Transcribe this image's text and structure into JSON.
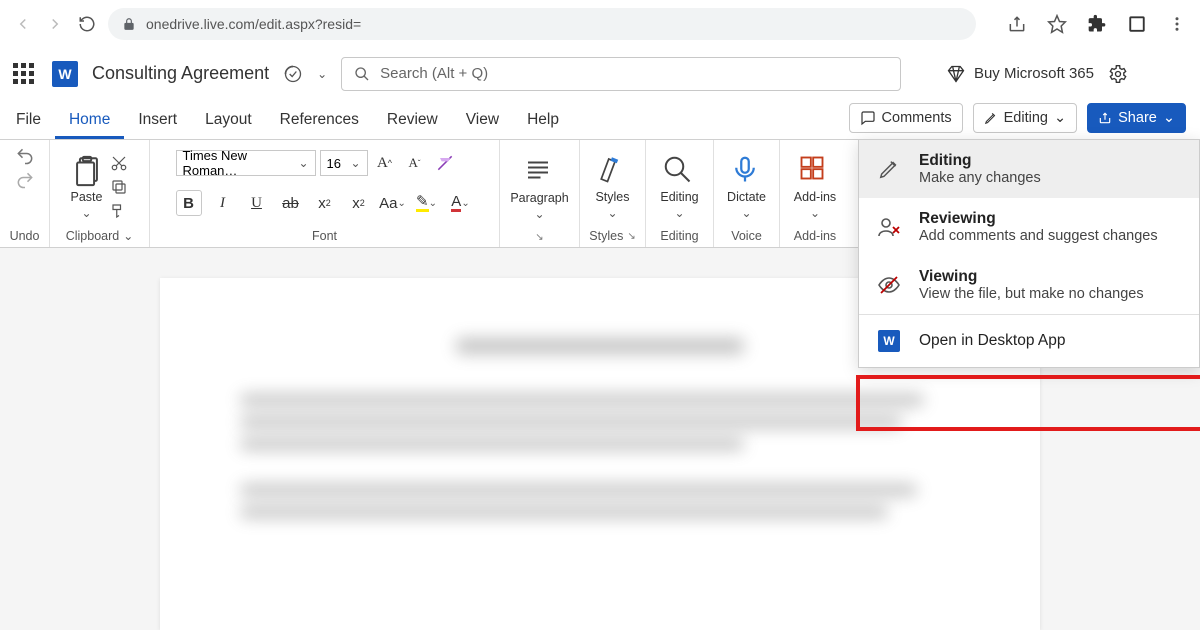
{
  "browser": {
    "url_display": "onedrive.live.com/edit.aspx?resid="
  },
  "header": {
    "doc_title": "Consulting Agreement",
    "search_placeholder": "Search (Alt + Q)",
    "buy_label": "Buy Microsoft 365"
  },
  "tabs": {
    "items": [
      "File",
      "Home",
      "Insert",
      "Layout",
      "References",
      "Review",
      "View",
      "Help"
    ],
    "active_index": 1,
    "comments_label": "Comments",
    "editing_label": "Editing",
    "share_label": "Share"
  },
  "ribbon": {
    "undo_label": "Undo",
    "clipboard_label": "Clipboard",
    "paste_label": "Paste",
    "font_label": "Font",
    "font_name": "Times New Roman…",
    "font_size": "16",
    "paragraph_label": "Paragraph",
    "styles_label": "Styles",
    "editing_group_label": "Editing",
    "dictate_label": "Dictate",
    "voice_label": "Voice",
    "addins_label": "Add-ins"
  },
  "editing_menu": {
    "items": [
      {
        "title": "Editing",
        "desc": "Make any changes"
      },
      {
        "title": "Reviewing",
        "desc": "Add comments and suggest changes"
      },
      {
        "title": "Viewing",
        "desc": "View the file, but make no changes"
      }
    ],
    "desktop_label": "Open in Desktop App"
  }
}
